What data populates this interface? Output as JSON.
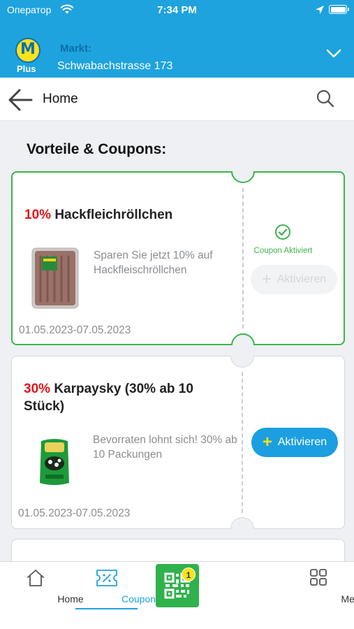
{
  "status_bar": {
    "carrier": "Оператор",
    "time": "7:34 PM"
  },
  "header": {
    "logo_text": "Plus",
    "markt_label": "Markt:",
    "markt_value": "Schwabachstrasse 173"
  },
  "nav": {
    "title": "Home"
  },
  "section": {
    "title": "Vorteile & Coupons:"
  },
  "coupons": [
    {
      "discount": "10%",
      "name": "Hackfleichröllchen",
      "description": "Sparen Sie jetzt 10% auf Hackfleischröllchen",
      "date": "01.05.2023-07.05.2023",
      "status_label": "Coupon Aktiviert",
      "button_label": "Aktivieren",
      "activated": true
    },
    {
      "discount": "30%",
      "name": "Karpaysky (30% ab 10 Stück)",
      "description": "Bevorraten lohnt sich! 30% ab 10 Packungen",
      "date": "01.05.2023-07.05.2023",
      "button_label": "Aktivieren",
      "activated": false
    }
  ],
  "tabs": {
    "home": "Home",
    "coupons": "Coupons",
    "menu": "Menu",
    "qr_badge": "1"
  },
  "colors": {
    "brand_blue": "#1ea3de",
    "accent_green": "#3cb54a",
    "discount_red": "#e3151b",
    "logo_yellow": "#ffe21a"
  }
}
